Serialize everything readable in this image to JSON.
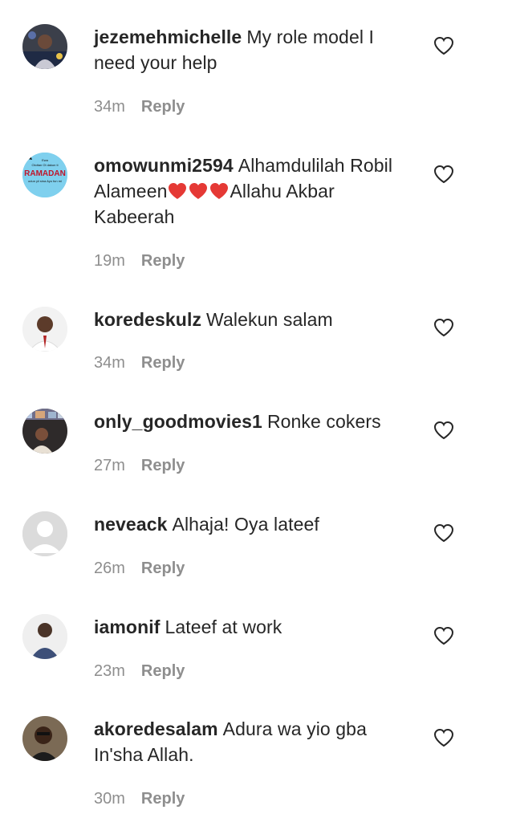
{
  "colors": {
    "text": "#262626",
    "meta": "#8e8e8e",
    "heart_emoji": "#e53935"
  },
  "comments": [
    {
      "username": "jezemehmichelle",
      "text_parts": [
        "My role model I need your help"
      ],
      "time": "34m",
      "reply_label": "Reply",
      "avatar": "avatar-photo"
    },
    {
      "username": "omowunmi2594",
      "text_parts": [
        "Alhamdulilah Robil Alameen",
        "Allahu Akbar Kabeerah"
      ],
      "emoji": "red-heart x3",
      "time": "19m",
      "reply_label": "Reply",
      "avatar": "avatar-ramadan-graphic"
    },
    {
      "username": "koredeskulz",
      "text_parts": [
        "Walekun salam"
      ],
      "time": "34m",
      "reply_label": "Reply",
      "avatar": "avatar-photo"
    },
    {
      "username": "only_goodmovies1",
      "text_parts": [
        "Ronke cokers"
      ],
      "time": "27m",
      "reply_label": "Reply",
      "avatar": "avatar-photo"
    },
    {
      "username": "neveack",
      "text_parts": [
        "Alhaja! Oya lateef"
      ],
      "time": "26m",
      "reply_label": "Reply",
      "avatar": "avatar-default"
    },
    {
      "username": "iamonif",
      "text_parts": [
        "Lateef at work"
      ],
      "time": "23m",
      "reply_label": "Reply",
      "avatar": "avatar-photo"
    },
    {
      "username": "akoredesalam",
      "text_parts": [
        "Adura wa yio gba In'sha Allah."
      ],
      "time": "30m",
      "reply_label": "Reply",
      "avatar": "avatar-photo"
    }
  ],
  "avatar_texts": {
    "ramadan_top": "Ewa",
    "ramadan_line": "Oloitan Ol dakun ti",
    "ramadan_title": "RAMADAN",
    "ramadan_bottom": "odun yii sina Ayo fun mi"
  }
}
